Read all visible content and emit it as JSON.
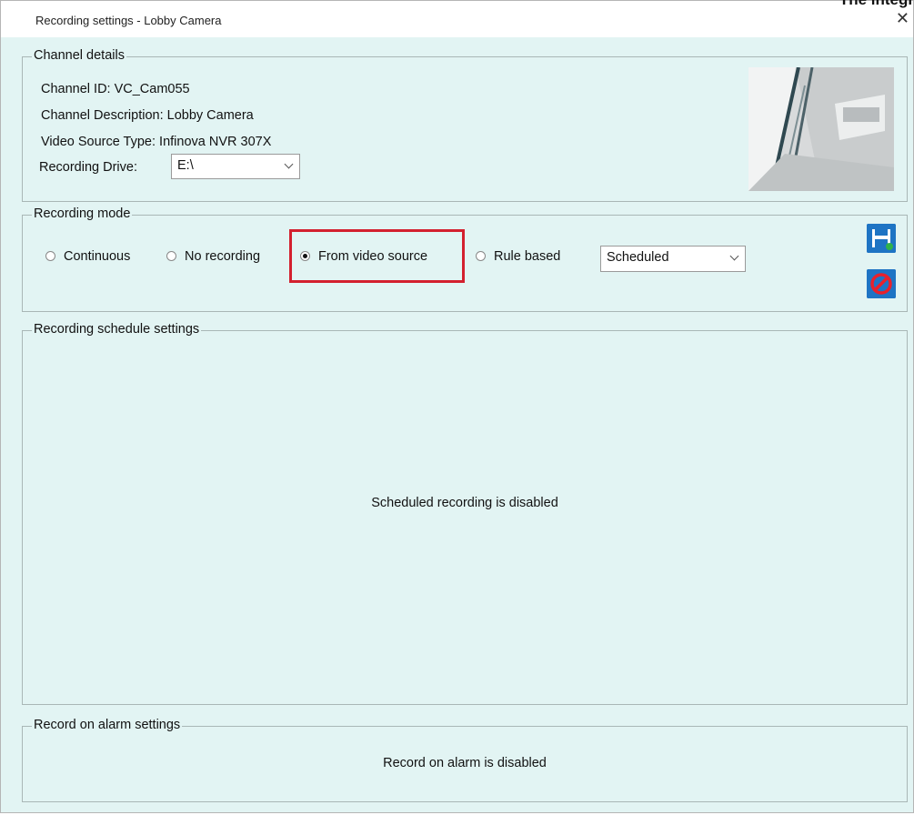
{
  "window": {
    "title": "Recording settings - Lobby Camera",
    "corner_text": "The integr"
  },
  "channel_details": {
    "legend": "Channel details",
    "channel_id": "Channel ID: VC_Cam055",
    "channel_description": "Channel Description: Lobby Camera",
    "video_source_type": "Video Source Type: Infinova NVR 307X",
    "recording_drive_label": "Recording Drive:",
    "recording_drive_value": "E:\\"
  },
  "recording_mode": {
    "legend": "Recording mode",
    "options": [
      "Continuous",
      "No recording",
      "From video source",
      "Rule based"
    ],
    "selected": "From video source",
    "rule_select_value": "Scheduled"
  },
  "schedule": {
    "legend": "Recording schedule settings",
    "message": "Scheduled recording is disabled"
  },
  "alarm": {
    "legend": "Record on alarm settings",
    "message": "Record on alarm is disabled"
  },
  "colors": {
    "background": "#e2f4f3",
    "highlight": "#d3202e",
    "save_icon": "#1e74c4",
    "cancel_icon": "#1e74c4"
  },
  "icons": {
    "close": "close-icon",
    "save": "save-icon",
    "cancel": "cancel-icon"
  }
}
